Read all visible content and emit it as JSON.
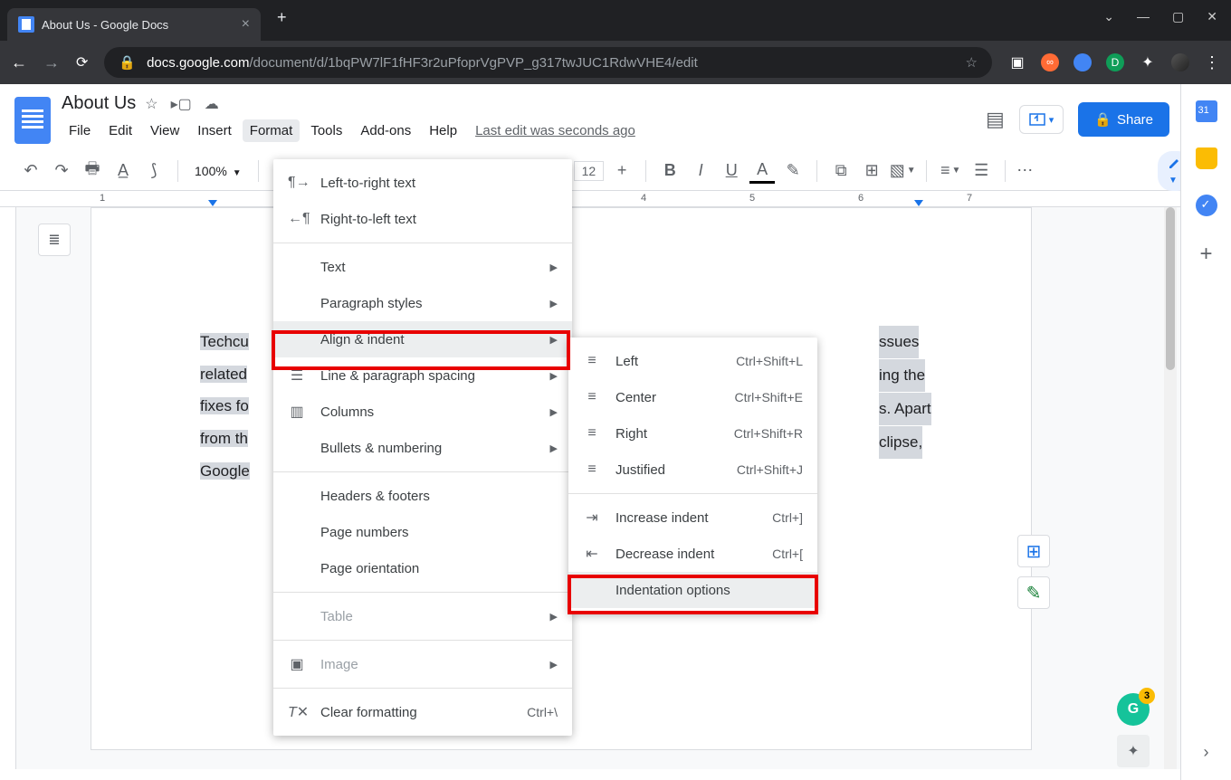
{
  "window": {
    "tab_title": "About Us - Google Docs"
  },
  "browser": {
    "url_host": "docs.google.com",
    "url_path": "/document/d/1bqPW7lF1fHF3r2uPfoprVgPVP_g317twJUC1RdwVHE4/edit"
  },
  "doc": {
    "title": "About Us",
    "last_edit": "Last edit was seconds ago",
    "body_visible": "Techcult helps people solve issues related to offering the fixes for Apart from the eclipse, Google"
  },
  "menubar": {
    "file": "File",
    "edit": "Edit",
    "view": "View",
    "insert": "Insert",
    "format": "Format",
    "tools": "Tools",
    "addons": "Add-ons",
    "help": "Help"
  },
  "header": {
    "share": "Share"
  },
  "toolbar": {
    "zoom": "100%",
    "font_size": "12"
  },
  "format_menu": {
    "ltr": "Left-to-right text",
    "rtl": "Right-to-left text",
    "text": "Text",
    "para_styles": "Paragraph styles",
    "align_indent": "Align & indent",
    "line_spacing": "Line & paragraph spacing",
    "columns": "Columns",
    "bullets": "Bullets & numbering",
    "headers_footers": "Headers & footers",
    "page_numbers": "Page numbers",
    "page_orientation": "Page orientation",
    "table": "Table",
    "image": "Image",
    "clear_formatting": "Clear formatting",
    "clear_shortcut": "Ctrl+\\"
  },
  "align_submenu": {
    "left": "Left",
    "left_sc": "Ctrl+Shift+L",
    "center": "Center",
    "center_sc": "Ctrl+Shift+E",
    "right": "Right",
    "right_sc": "Ctrl+Shift+R",
    "justified": "Justified",
    "justified_sc": "Ctrl+Shift+J",
    "increase": "Increase indent",
    "increase_sc": "Ctrl+]",
    "decrease": "Decrease indent",
    "decrease_sc": "Ctrl+[",
    "options": "Indentation options"
  },
  "ruler": {
    "t1": "1",
    "t4": "4",
    "t5": "5",
    "t6": "6",
    "t7": "7"
  }
}
